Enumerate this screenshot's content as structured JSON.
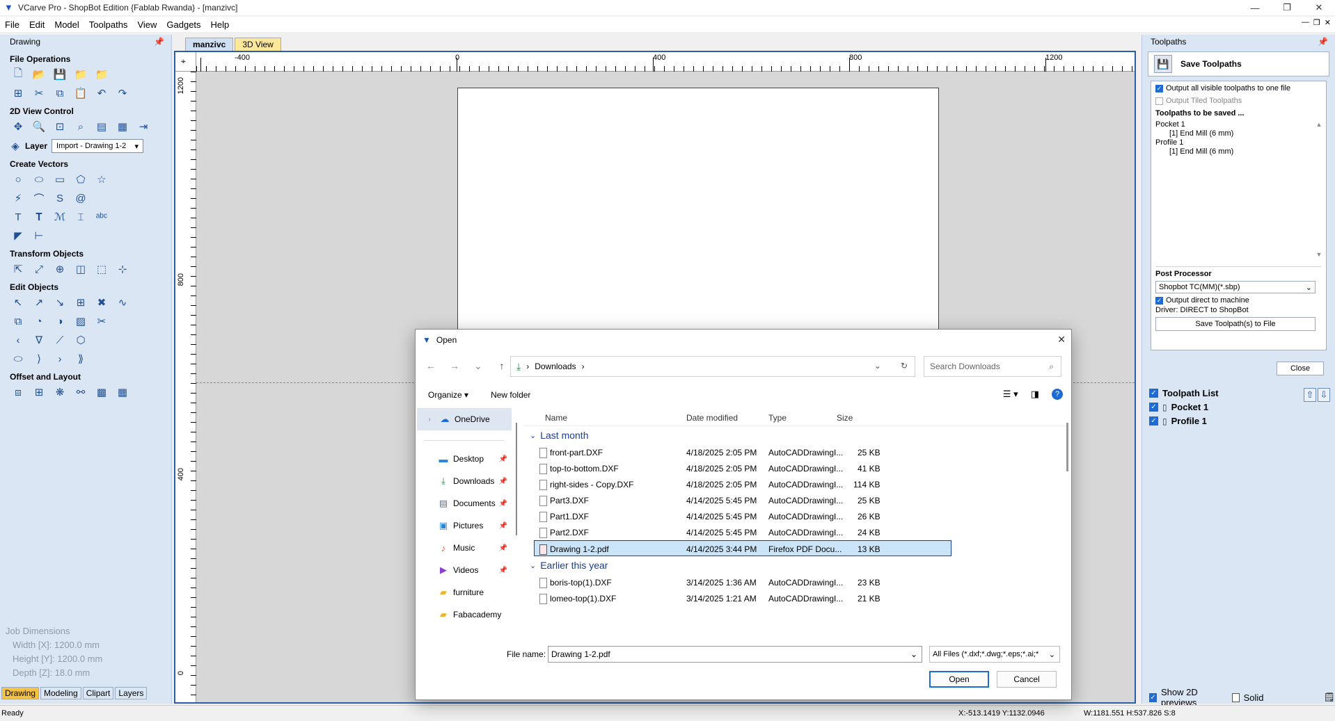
{
  "window": {
    "title": "VCarve Pro - ShopBot Edition {Fablab Rwanda} - [manzivc]"
  },
  "menu": [
    "File",
    "Edit",
    "Model",
    "Toolpaths",
    "View",
    "Gadgets",
    "Help"
  ],
  "left_panel": {
    "title": "Drawing",
    "sections": {
      "file_operations": "File Operations",
      "view_control": "2D View Control",
      "create_vectors": "Create Vectors",
      "transform_objects": "Transform Objects",
      "edit_objects": "Edit Objects",
      "offset_layout": "Offset and Layout"
    },
    "layer_label": "Layer",
    "layer_value": "Import - Drawing 1-2",
    "job_dimensions": {
      "title": "Job Dimensions",
      "width": "Width  [X]: 1200.0 mm",
      "height": "Height [Y]: 1200.0 mm",
      "depth": "Depth  [Z]: 18.0 mm"
    },
    "tabs": [
      "Drawing",
      "Modeling",
      "Clipart",
      "Layers"
    ]
  },
  "doc_tabs": [
    "manzivc",
    "3D View"
  ],
  "rulers": {
    "top": [
      "-400",
      "0",
      "400",
      "800",
      "1200"
    ],
    "left": [
      "1200",
      "800",
      "400",
      "0"
    ]
  },
  "right_panel": {
    "title": "Toolpaths",
    "save_title": "Save Toolpaths",
    "output_all": "Output all visible toolpaths to one file",
    "output_tiled": "Output Tiled Toolpaths",
    "to_be_saved": "Toolpaths to be saved ...",
    "saved_list": [
      {
        "name": "Pocket 1",
        "tool": "[1] End Mill (6 mm)"
      },
      {
        "name": "Profile 1",
        "tool": "[1] End Mill (6 mm)"
      }
    ],
    "post_processor_label": "Post Processor",
    "post_processor_value": "Shopbot TC(MM)(*.sbp)",
    "output_direct": "Output direct to machine",
    "driver": "Driver: DIRECT to ShopBot",
    "save_button": "Save Toolpath(s) to File",
    "close_button": "Close",
    "toolpath_list_title": "Toolpath List",
    "toolpath_list": [
      "Pocket 1",
      "Profile 1"
    ],
    "show_2d": "Show 2D previews",
    "solid": "Solid"
  },
  "status": {
    "left": "Ready",
    "coords": "X:-513.1419 Y:1132.0946",
    "dims": "W:1181.551   H:537.826  S:8"
  },
  "dialog": {
    "title": "Open",
    "breadcrumb": "Downloads",
    "search_placeholder": "Search Downloads",
    "organize": "Organize",
    "new_folder": "New folder",
    "nav": {
      "onedrive": "OneDrive",
      "desktop": "Desktop",
      "downloads": "Downloads",
      "documents": "Documents",
      "pictures": "Pictures",
      "music": "Music",
      "videos": "Videos",
      "furniture": "furniture",
      "fabacademy": "Fabacademy"
    },
    "columns": {
      "name": "Name",
      "date": "Date modified",
      "type": "Type",
      "size": "Size"
    },
    "groups": {
      "last_month": "Last month",
      "earlier": "Earlier this year"
    },
    "files_last_month": [
      {
        "name": "front-part.DXF",
        "date": "4/18/2025 2:05 PM",
        "type": "AutoCADDrawingI...",
        "size": "25 KB"
      },
      {
        "name": "top-to-bottom.DXF",
        "date": "4/18/2025 2:05 PM",
        "type": "AutoCADDrawingI...",
        "size": "41 KB"
      },
      {
        "name": "right-sides - Copy.DXF",
        "date": "4/18/2025 2:05 PM",
        "type": "AutoCADDrawingI...",
        "size": "114 KB"
      },
      {
        "name": "Part3.DXF",
        "date": "4/14/2025 5:45 PM",
        "type": "AutoCADDrawingI...",
        "size": "25 KB"
      },
      {
        "name": "Part1.DXF",
        "date": "4/14/2025 5:45 PM",
        "type": "AutoCADDrawingI...",
        "size": "26 KB"
      },
      {
        "name": "Part2.DXF",
        "date": "4/14/2025 5:45 PM",
        "type": "AutoCADDrawingI...",
        "size": "24 KB"
      },
      {
        "name": "Drawing 1-2.pdf",
        "date": "4/14/2025 3:44 PM",
        "type": "Firefox PDF Docu...",
        "size": "13 KB"
      }
    ],
    "files_earlier": [
      {
        "name": "boris-top(1).DXF",
        "date": "3/14/2025 1:36 AM",
        "type": "AutoCADDrawingI...",
        "size": "23 KB"
      },
      {
        "name": "lomeo-top(1).DXF",
        "date": "3/14/2025 1:21 AM",
        "type": "AutoCADDrawingI...",
        "size": "21 KB"
      }
    ],
    "file_name_label": "File name:",
    "file_name_value": "Drawing 1-2.pdf",
    "file_type": "All Files (*.dxf;*.dwg;*.eps;*.ai;*",
    "open_button": "Open",
    "cancel_button": "Cancel"
  }
}
